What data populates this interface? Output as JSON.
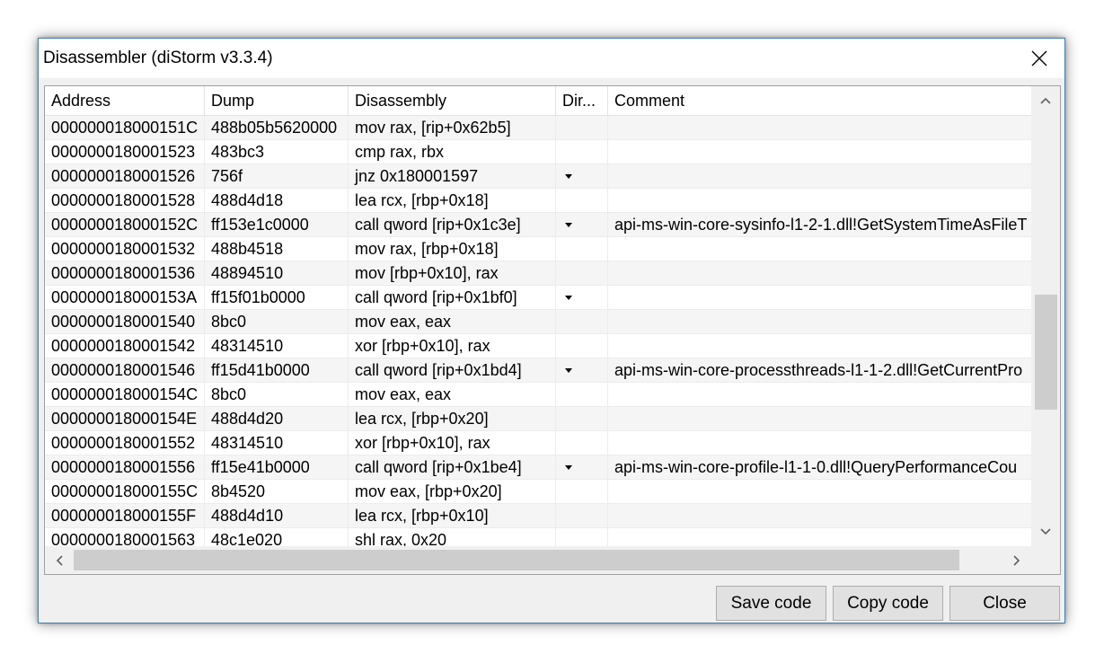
{
  "window": {
    "title": "Disassembler (diStorm v3.3.4)"
  },
  "columns": [
    "Address",
    "Dump",
    "Disassembly",
    "Dir...",
    "Comment"
  ],
  "rows": [
    {
      "address": "000000018000151C",
      "dump": "488b05b5620000",
      "disassembly": "mov rax, [rip+0x62b5]",
      "dir": "",
      "comment": ""
    },
    {
      "address": "0000000180001523",
      "dump": "483bc3",
      "disassembly": "cmp rax, rbx",
      "dir": "",
      "comment": ""
    },
    {
      "address": "0000000180001526",
      "dump": "756f",
      "disassembly": "jnz 0x180001597",
      "dir": "down",
      "comment": ""
    },
    {
      "address": "0000000180001528",
      "dump": "488d4d18",
      "disassembly": "lea rcx, [rbp+0x18]",
      "dir": "",
      "comment": ""
    },
    {
      "address": "000000018000152C",
      "dump": "ff153e1c0000",
      "disassembly": "call qword [rip+0x1c3e]",
      "dir": "down",
      "comment": "api-ms-win-core-sysinfo-l1-2-1.dll!GetSystemTimeAsFileT"
    },
    {
      "address": "0000000180001532",
      "dump": "488b4518",
      "disassembly": "mov rax, [rbp+0x18]",
      "dir": "",
      "comment": ""
    },
    {
      "address": "0000000180001536",
      "dump": "48894510",
      "disassembly": "mov [rbp+0x10], rax",
      "dir": "",
      "comment": ""
    },
    {
      "address": "000000018000153A",
      "dump": "ff15f01b0000",
      "disassembly": "call qword [rip+0x1bf0]",
      "dir": "down",
      "comment": ""
    },
    {
      "address": "0000000180001540",
      "dump": "8bc0",
      "disassembly": "mov eax, eax",
      "dir": "",
      "comment": ""
    },
    {
      "address": "0000000180001542",
      "dump": "48314510",
      "disassembly": "xor [rbp+0x10], rax",
      "dir": "",
      "comment": ""
    },
    {
      "address": "0000000180001546",
      "dump": "ff15d41b0000",
      "disassembly": "call qword [rip+0x1bd4]",
      "dir": "down",
      "comment": "api-ms-win-core-processthreads-l1-1-2.dll!GetCurrentPro"
    },
    {
      "address": "000000018000154C",
      "dump": "8bc0",
      "disassembly": "mov eax, eax",
      "dir": "",
      "comment": ""
    },
    {
      "address": "000000018000154E",
      "dump": "488d4d20",
      "disassembly": "lea rcx, [rbp+0x20]",
      "dir": "",
      "comment": ""
    },
    {
      "address": "0000000180001552",
      "dump": "48314510",
      "disassembly": "xor [rbp+0x10], rax",
      "dir": "",
      "comment": ""
    },
    {
      "address": "0000000180001556",
      "dump": "ff15e41b0000",
      "disassembly": "call qword [rip+0x1be4]",
      "dir": "down",
      "comment": "api-ms-win-core-profile-l1-1-0.dll!QueryPerformanceCou"
    },
    {
      "address": "000000018000155C",
      "dump": "8b4520",
      "disassembly": "mov eax, [rbp+0x20]",
      "dir": "",
      "comment": ""
    },
    {
      "address": "000000018000155F",
      "dump": "488d4d10",
      "disassembly": "lea rcx, [rbp+0x10]",
      "dir": "",
      "comment": ""
    },
    {
      "address": "0000000180001563",
      "dump": "48c1e020",
      "disassembly": "shl rax, 0x20",
      "dir": "",
      "comment": ""
    }
  ],
  "buttons": {
    "save": "Save code",
    "copy": "Copy code",
    "close": "Close"
  },
  "colors": {
    "window_border": "#3c7fb1",
    "dialog_bg": "#f0f0f0",
    "alt_row": "#f5f5f5",
    "button_bg": "#e1e1e1"
  }
}
